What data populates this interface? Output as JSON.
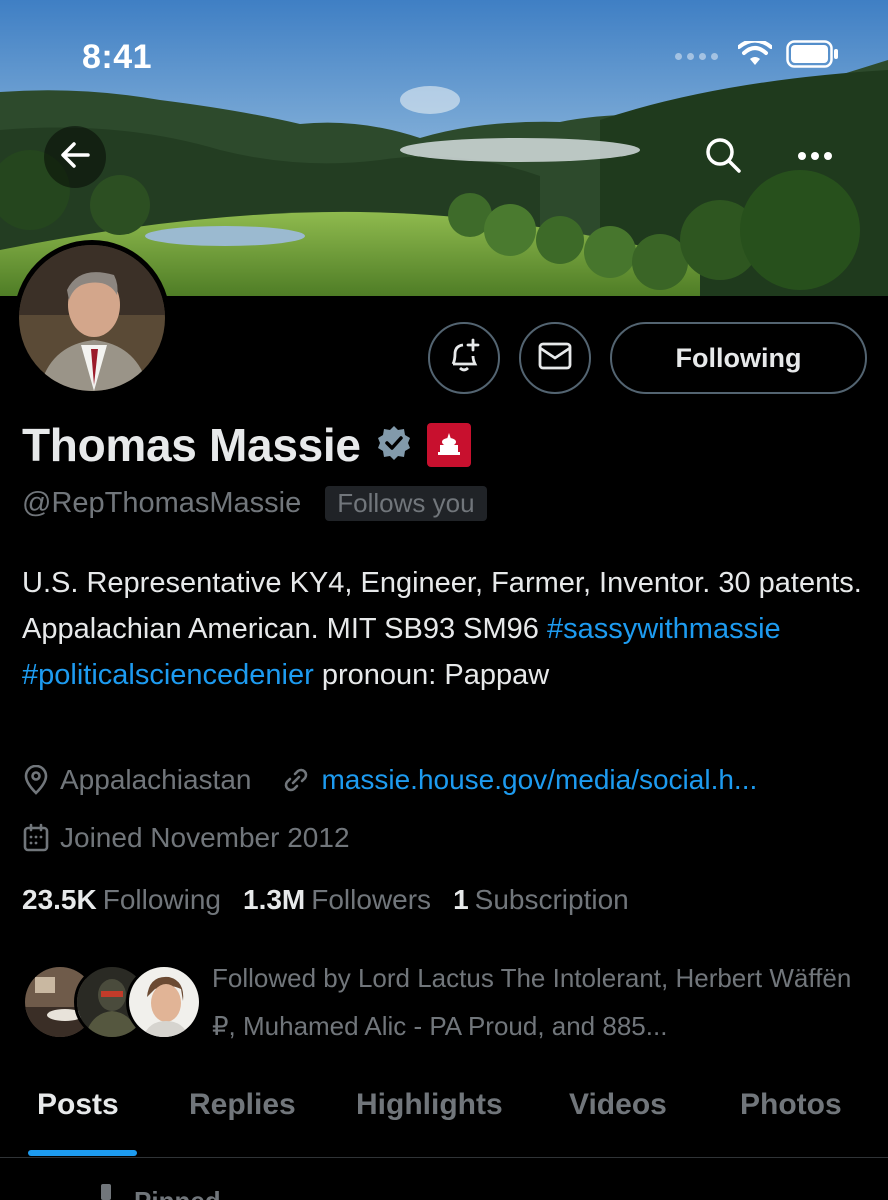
{
  "status_bar": {
    "time": "8:41"
  },
  "header": {
    "back_icon": "arrow-left-icon",
    "search_icon": "search-icon",
    "more_icon": "more-horizontal-icon"
  },
  "profile": {
    "name": "Thomas Massie",
    "handle": "@RepThomasMassie",
    "follows_you": "Follows you",
    "verified_color": "#829aab",
    "bio": {
      "line_text": "U.S. Representative KY4, Engineer, Farmer, Inventor. 30 patents. Appalachian American. MIT SB93 SM96",
      "hashtag1": "#sassywithmassie",
      "hashtag2": "#politicalsciencedenier",
      "tail": "pronoun: Pappaw"
    },
    "location": "Appalachiastan",
    "website": "massie.house.gov/media/social.h...",
    "joined": "Joined November 2012"
  },
  "actions": {
    "following_label": "Following",
    "notify_icon": "bell-plus-icon",
    "message_icon": "envelope-icon"
  },
  "counts": {
    "following_value": "23.5K",
    "following_label": "Following",
    "followers_value": "1.3M",
    "followers_label": "Followers",
    "subscription_value": "1",
    "subscription_label": "Subscription"
  },
  "followed_by": "Followed by Lord Lactus The Intolerant, Herbert Wäffën ₽, Muhamed Alic - PA Proud, and 885...",
  "tabs": [
    "Posts",
    "Replies",
    "Highlights",
    "Videos",
    "Photos"
  ],
  "pinned_label": "Pinned",
  "colors": {
    "accent": "#1d9bf0",
    "badge_red": "#c8102e",
    "muted": "#71767b"
  }
}
